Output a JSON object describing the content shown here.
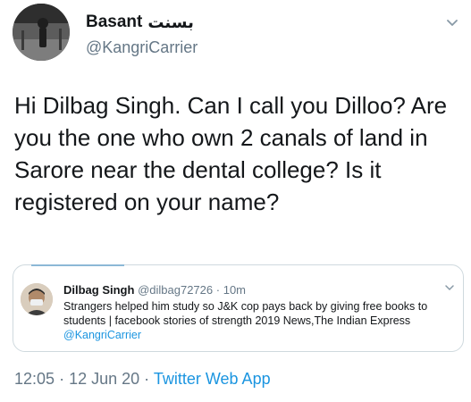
{
  "author": {
    "display_name": "Basant",
    "display_name_alt": "بسنت",
    "handle": "@KangriCarrier"
  },
  "tweet": {
    "text": "Hi Dilbag Singh. Can I call you Dilloo? Are you the one who own 2 canals of land in Sarore near the dental college? Is it registered on your name?"
  },
  "quoted": {
    "display_name": "Dilbag Singh",
    "handle": "@dilbag72726",
    "separator": "·",
    "time": "10m",
    "text": "Strangers helped him study so J&K cop pays back by giving free books to students | facebook stories of strength 2019 News,The Indian Express",
    "mention": "@KangriCarrier"
  },
  "meta": {
    "time": "12:05",
    "sep1": "·",
    "date": "12 Jun 20",
    "sep2": "·",
    "app": "Twitter Web App"
  },
  "colors": {
    "link": "#1b95e0",
    "secondary": "#657786",
    "border": "#cfd9de"
  },
  "icons": {
    "caret": "chevron-down-icon",
    "author_avatar": "avatar",
    "quoted_avatar": "avatar"
  }
}
